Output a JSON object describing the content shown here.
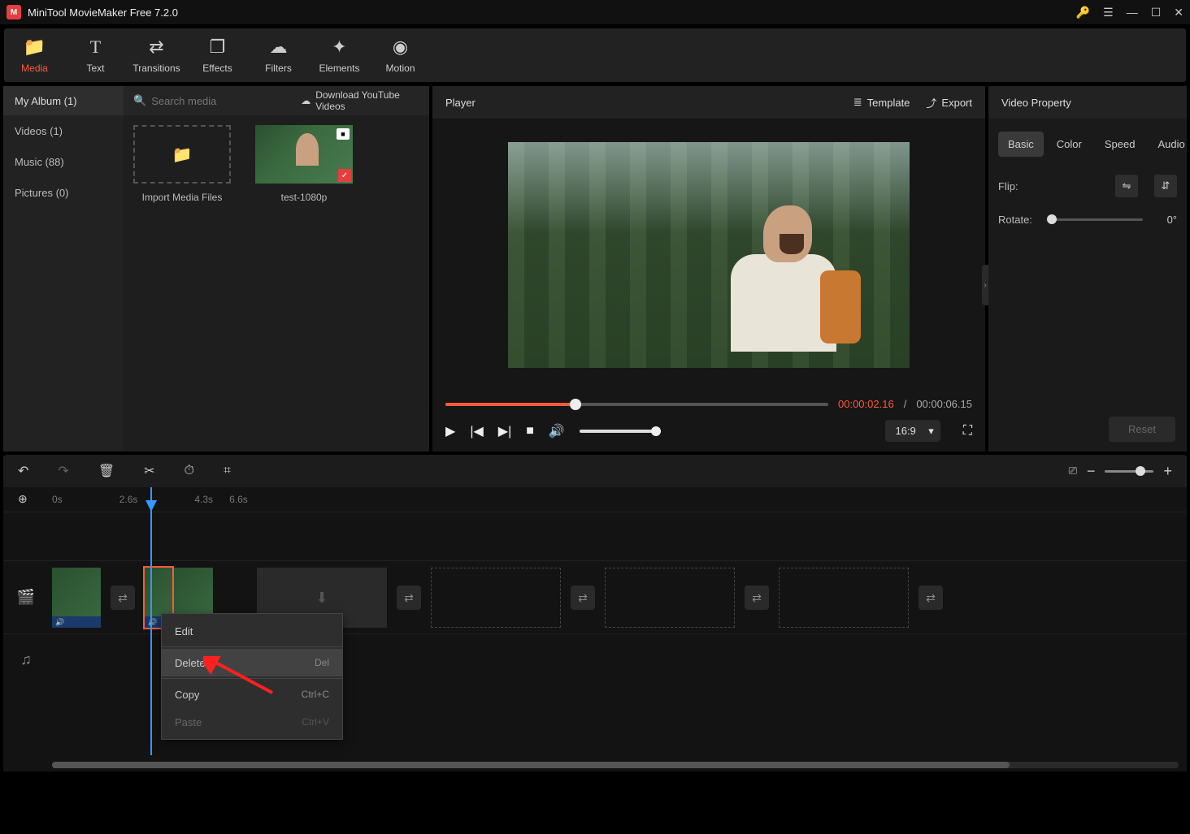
{
  "app": {
    "title": "MiniTool MovieMaker Free 7.2.0"
  },
  "toolbar_tabs": [
    {
      "icon": "📁",
      "label": "Media",
      "active": true
    },
    {
      "icon": "T",
      "label": "Text"
    },
    {
      "icon": "⇄",
      "label": "Transitions"
    },
    {
      "icon": "❐",
      "label": "Effects"
    },
    {
      "icon": "☁",
      "label": "Filters"
    },
    {
      "icon": "✦",
      "label": "Elements"
    },
    {
      "icon": "◉",
      "label": "Motion"
    }
  ],
  "sidebar": {
    "album": "My Album (1)",
    "items": [
      "Videos (1)",
      "Music (88)",
      "Pictures (0)"
    ]
  },
  "media": {
    "search_placeholder": "Search media",
    "download_label": "Download YouTube Videos",
    "import_label": "Import Media Files",
    "clip_label": "test-1080p"
  },
  "player": {
    "title": "Player",
    "template_label": "Template",
    "export_label": "Export",
    "time_current": "00:00:02.16",
    "time_total": "00:00:06.15",
    "aspect": "16:9"
  },
  "property": {
    "title": "Video Property",
    "tabs": [
      "Basic",
      "Color",
      "Speed",
      "Audio"
    ],
    "flip_label": "Flip:",
    "rotate_label": "Rotate:",
    "rotate_value": "0°",
    "reset_label": "Reset"
  },
  "timeline": {
    "ticks": [
      "0s",
      "2.6s",
      "4.3s",
      "6.6s"
    ]
  },
  "context_menu": {
    "items": [
      {
        "label": "Edit",
        "shortcut": ""
      },
      {
        "label": "Delete",
        "shortcut": "Del",
        "highlighted": true
      },
      {
        "label": "Copy",
        "shortcut": "Ctrl+C"
      },
      {
        "label": "Paste",
        "shortcut": "Ctrl+V",
        "disabled": true
      }
    ]
  }
}
